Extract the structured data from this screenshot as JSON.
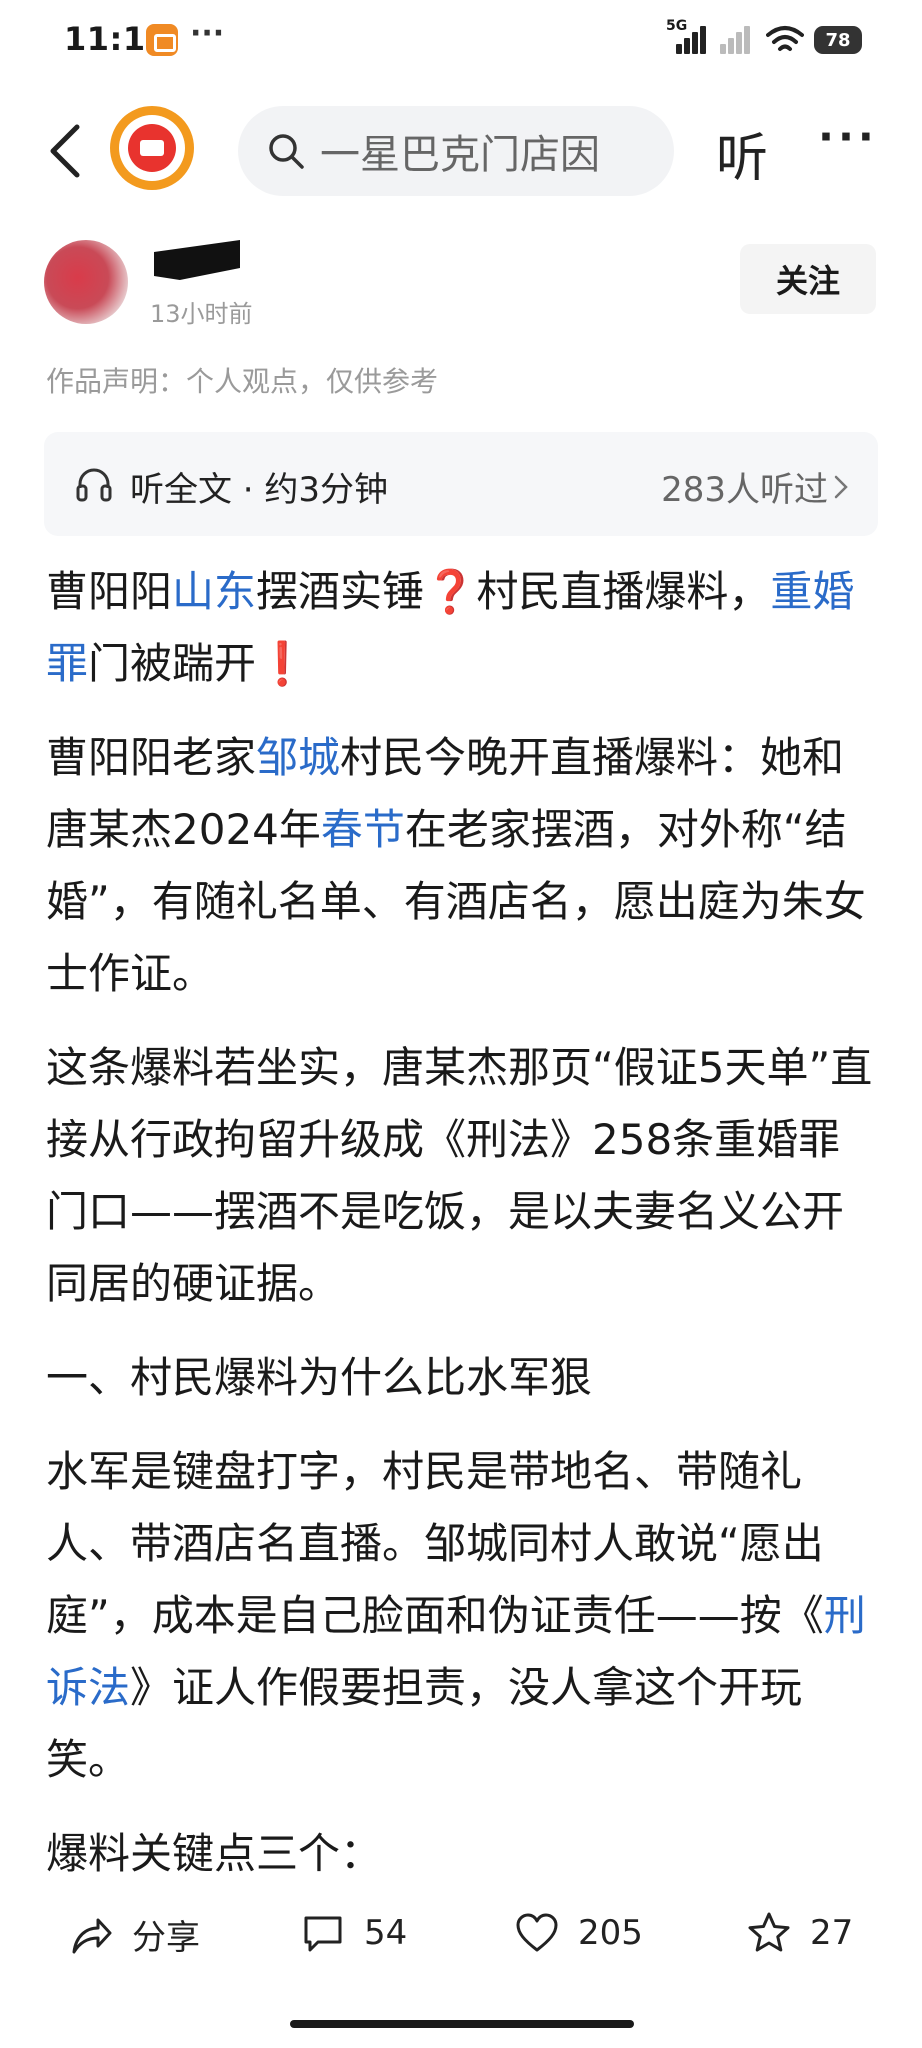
{
  "status_bar": {
    "time": "11:12",
    "dots": "···",
    "network_tag": "5G",
    "battery": "78"
  },
  "topnav": {
    "search_text": "一星巴克门店因",
    "listen_label": "听",
    "more_label": "···"
  },
  "author": {
    "time": "13小时前",
    "follow_label": "关注"
  },
  "statement": "作品声明：个人观点，仅供参考",
  "listen_card": {
    "label": "听全文 · 约3分钟",
    "count": "283人听过"
  },
  "article": {
    "p1": {
      "a": "曹阳阳",
      "tag1": "山东",
      "b": "摆酒实锤",
      "q": "❓",
      "c": "村民直播爆料，",
      "tag2": "重婚罪",
      "d": "门被踹开",
      "e": "❗"
    },
    "p2": {
      "a": "曹阳阳老家",
      "tag1": "邹城",
      "b": "村民今晚开直播爆料：她和唐某杰2024年",
      "tag2": "春节",
      "c": "在老家摆酒，对外称“结婚”，有随礼名单、有酒店名，愿出庭为朱女士作证。"
    },
    "p3": "这条爆料若坐实，唐某杰那页“假证5天单”直接从行政拘留升级成《刑法》258条重婚罪门口——摆酒不是吃饭，是以夫妻名义公开同居的硬证据。",
    "p4": "一、村民爆料为什么比水军狠",
    "p5": {
      "a": "水军是键盘打字，村民是带地名、带随礼人、带酒店名直播。邹城同村人敢说“愿出庭”，成本是自己脸面和伪证责任——按《",
      "tag": "刑诉法",
      "b": "》证人作假要担责，没人拿这个开玩笑。"
    },
    "p6": "爆料关键点三个："
  },
  "actions": {
    "share": "分享",
    "comment": "54",
    "like": "205",
    "collect": "27"
  },
  "colors": {
    "link": "#2a6bc9",
    "accent_orange": "#f39a1e",
    "emoji_red": "#e13c3c"
  }
}
